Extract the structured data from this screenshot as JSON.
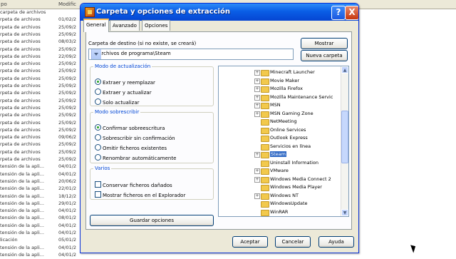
{
  "background_list": {
    "header": {
      "col1": "po",
      "col2": "Modific"
    },
    "rows": [
      {
        "name": "carpeta de archivos",
        "date": ""
      },
      {
        "name": "rpeta de archivos",
        "date": "01/02/2"
      },
      {
        "name": "rpeta de archivos",
        "date": "25/09/2"
      },
      {
        "name": "rpeta de archivos",
        "date": "25/09/2"
      },
      {
        "name": "rpeta de archivos",
        "date": "08/03/2"
      },
      {
        "name": "rpeta de archivos",
        "date": "25/09/2"
      },
      {
        "name": "rpeta de archivos",
        "date": "22/09/2"
      },
      {
        "name": "rpeta de archivos",
        "date": "25/09/2"
      },
      {
        "name": "rpeta de archivos",
        "date": "25/09/2"
      },
      {
        "name": "rpeta de archivos",
        "date": "25/09/2"
      },
      {
        "name": "rpeta de archivos",
        "date": "25/09/2"
      },
      {
        "name": "rpeta de archivos",
        "date": "25/09/2"
      },
      {
        "name": "rpeta de archivos",
        "date": "25/09/2"
      },
      {
        "name": "rpeta de archivos",
        "date": "25/09/2"
      },
      {
        "name": "rpeta de archivos",
        "date": "25/09/2"
      },
      {
        "name": "rpeta de archivos",
        "date": "25/09/2"
      },
      {
        "name": "rpeta de archivos",
        "date": "25/09/2"
      },
      {
        "name": "rpeta de archivos",
        "date": "09/06/2"
      },
      {
        "name": "rpeta de archivos",
        "date": "25/09/2"
      },
      {
        "name": "rpeta de archivos",
        "date": "25/09/2"
      },
      {
        "name": "rpeta de archivos",
        "date": "25/09/2"
      },
      {
        "name": "tensión de la apli...",
        "date": "04/01/2"
      },
      {
        "name": "tensión de la apli...",
        "date": "04/01/2"
      },
      {
        "name": "tensión de la apli...",
        "date": "20/06/2"
      },
      {
        "name": "tensión de la apli...",
        "date": "22/01/2"
      },
      {
        "name": "tensión de la apli...",
        "date": "18/12/2"
      },
      {
        "name": "tensión de la apli...",
        "date": "29/01/2"
      },
      {
        "name": "tensión de la apli...",
        "date": "04/01/2"
      },
      {
        "name": "tensión de la apli...",
        "date": "08/01/2"
      },
      {
        "name": "tensión de la apli...",
        "date": "04/01/2"
      },
      {
        "name": "tensión de la apli...",
        "date": "04/01/2"
      },
      {
        "name": "licación",
        "date": "05/01/2"
      },
      {
        "name": "tensión de la apli...",
        "date": "04/01/2"
      },
      {
        "name": "tensión de la apli...",
        "date": "04/01/2"
      }
    ]
  },
  "dialog": {
    "title": "Carpeta y opciones de extracción",
    "help_label": "?",
    "close_label": "X",
    "tabs": [
      "General",
      "Avanzado",
      "Opciones"
    ],
    "dest_label": "Carpeta de destino (si no existe, se creará)",
    "dest_value": "C:\\Archivos de programa\\Steam",
    "show_button": "Mostrar",
    "new_folder_button": "Nueva carpeta",
    "update_mode": {
      "legend": "Modo de actualización",
      "options": [
        "Extraer y reemplazar",
        "Extraer y actualizar",
        "Solo actualizar"
      ],
      "selected": 0
    },
    "overwrite_mode": {
      "legend": "Modo sobrescribir",
      "options": [
        "Confirmar sobreescritura",
        "Sobrescribir sin confirmación",
        "Omitir ficheros existentes",
        "Renombrar automáticamente"
      ],
      "selected": 0
    },
    "misc": {
      "legend": "Varios",
      "options": [
        "Conservar ficheros dañados",
        "Mostrar ficheros en el Explorador"
      ]
    },
    "save_options_button": "Guardar opciones",
    "tree": [
      {
        "label": "Minecraft Launcher",
        "expander": "+"
      },
      {
        "label": "Movie Maker",
        "expander": "+"
      },
      {
        "label": "Mozilla Firefox",
        "expander": "+"
      },
      {
        "label": "Mozilla Maintenance Servic",
        "expander": "+"
      },
      {
        "label": "MSN",
        "expander": "+"
      },
      {
        "label": "MSN Gaming Zone",
        "expander": "+"
      },
      {
        "label": "NetMeeting",
        "expander": ""
      },
      {
        "label": "Online Services",
        "expander": ""
      },
      {
        "label": "Outlook Express",
        "expander": ""
      },
      {
        "label": "Servicios en línea",
        "expander": ""
      },
      {
        "label": "Steam",
        "expander": "+",
        "selected": true
      },
      {
        "label": "Uninstall Information",
        "expander": ""
      },
      {
        "label": "VMware",
        "expander": "+"
      },
      {
        "label": "Windows Media Connect 2",
        "expander": "+"
      },
      {
        "label": "Windows Media Player",
        "expander": ""
      },
      {
        "label": "Windows NT",
        "expander": "+"
      },
      {
        "label": "WindowsUpdate",
        "expander": ""
      },
      {
        "label": "WinRAR",
        "expander": ""
      }
    ],
    "ok_button": "Aceptar",
    "cancel_button": "Cancelar",
    "help_button": "Ayuda"
  }
}
